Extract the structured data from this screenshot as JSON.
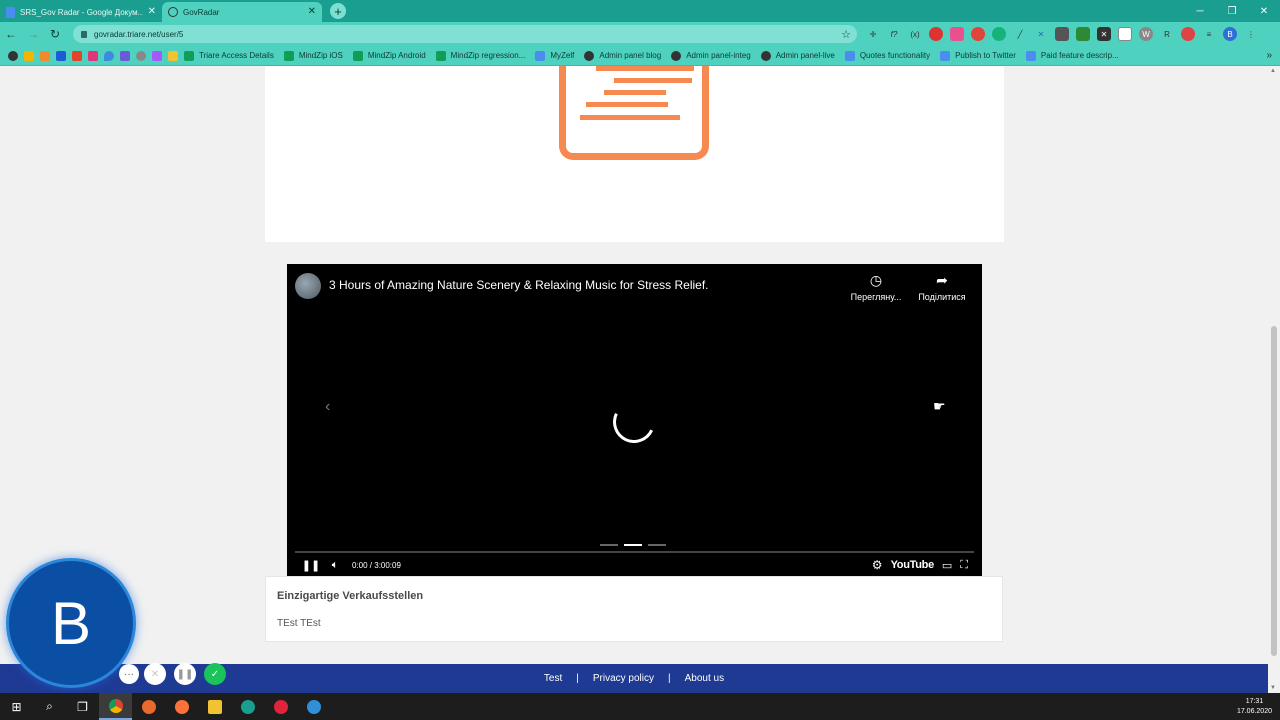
{
  "browser": {
    "tabs": [
      {
        "title": "SRS_Gov Radar - Google Докум...",
        "active": false
      },
      {
        "title": "GovRadar",
        "active": true
      }
    ],
    "url": "govradar.triare.net/user/5",
    "bookmarks": [
      "Triare Access Details",
      "MindZip iOS",
      "MindZip Android",
      "MindZip regression...",
      "MyZelf",
      "Admin panel blog",
      "Admin panel-integ",
      "Admin panel-live",
      "Quotes functionality",
      "Publish to Twitter",
      "Paid feature descrip..."
    ],
    "profile_initial": "B",
    "ext_letter": "R"
  },
  "video": {
    "title": "3 Hours of Amazing Nature Scenery & Relaxing Music for Stress Relief.",
    "watch_later": "Перегляну...",
    "share": "Поділитися",
    "time": "0:00 / 3:00:09",
    "brand": "YouTube",
    "progress": 0
  },
  "feature": {
    "title": "Einzigartige Verkaufsstellen",
    "text": "TEst TEst"
  },
  "footer": {
    "links": [
      "Test",
      "Privacy policy",
      "About us"
    ],
    "separator": "|"
  },
  "recorder": {
    "avatar_initial": "B"
  },
  "taskbar": {
    "time": "17:31",
    "date": "17.06.2020"
  },
  "colors": {
    "chrome_teal": "#4fd1bf",
    "tabbar_teal": "#1a9e8f",
    "accent_orange": "#f5894f",
    "footer_blue": "#1f3a93",
    "recorder_blue": "#0a4fa3"
  }
}
